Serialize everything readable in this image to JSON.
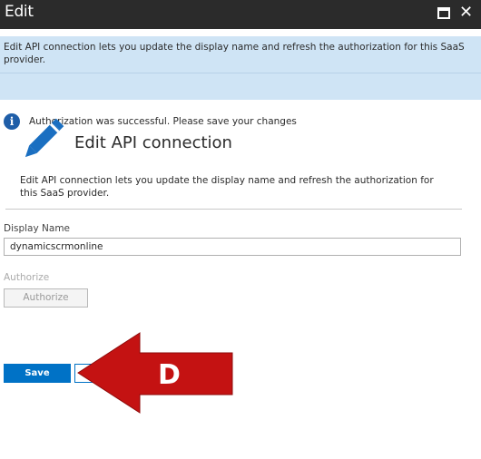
{
  "window": {
    "title": "Edit",
    "maximize_icon": "maximize-icon",
    "close_icon": "close-icon",
    "close_glyph": "✕"
  },
  "infobar": {
    "description": "Edit API connection lets you update the display name and refresh the authorization for this SaaS provider.",
    "status_icon": "info-icon",
    "status_icon_glyph": "i",
    "status_text": "Authorization was successful. Please save your changes"
  },
  "header": {
    "icon": "pencil-icon",
    "title": "Edit API connection",
    "description": "Edit API connection lets you update the display name and refresh the authorization for this SaaS provider."
  },
  "form": {
    "display_name_label": "Display Name",
    "display_name_value": "dynamicscrmonline",
    "authorize_label": "Authorize",
    "authorize_button": "Authorize"
  },
  "footer": {
    "save_button": "Save"
  },
  "annotation": {
    "letter": "D",
    "color": "#c41212"
  },
  "colors": {
    "titlebar": "#2b2b2b",
    "infobar": "#cfe4f5",
    "accent": "#0072c6",
    "pencil": "#1a6fc1"
  }
}
